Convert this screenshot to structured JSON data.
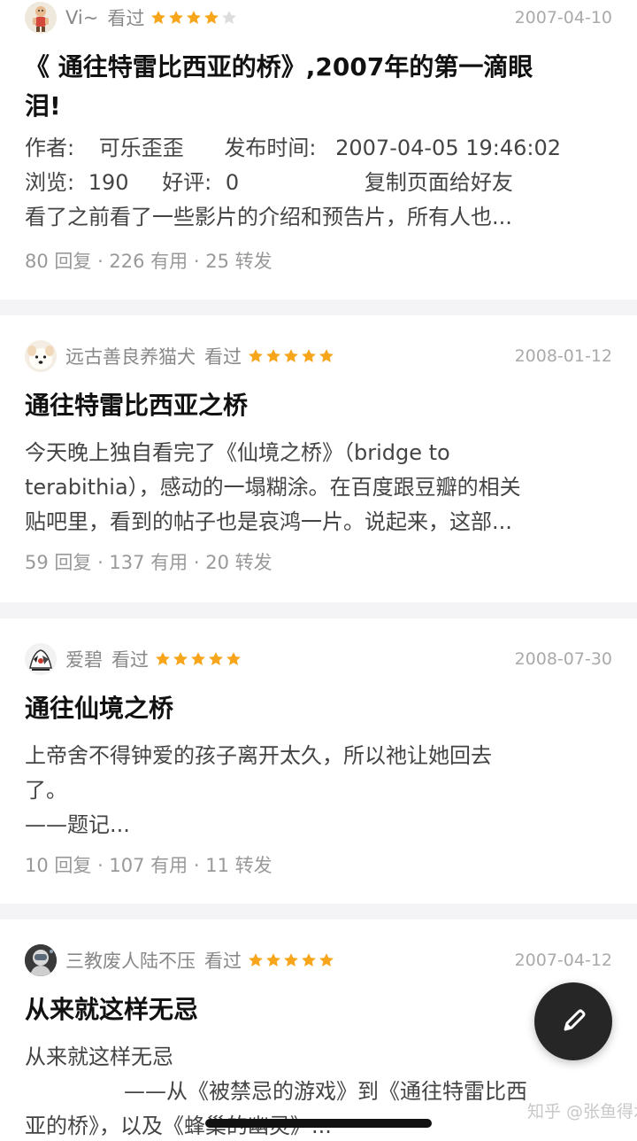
{
  "reviews": [
    {
      "username": "Vi~",
      "status": "看过",
      "rating": 4,
      "date": "2007-04-10",
      "title_line1": "《 通往特雷比西亚的桥》,2007年的第一滴眼",
      "title_line2": "泪!",
      "author_label": "作者:",
      "author_name": "可乐歪歪",
      "publish_label": "发布时间:",
      "publish_time": "2007-04-05 19:46:02",
      "views_label": "浏览:",
      "views_value": "190",
      "likes_label": "好评:",
      "likes_value": "0",
      "copy_text": "复制页面给好友",
      "excerpt": "看了之前看了一些影片的介绍和预告片，所有人也...",
      "stats": "80 回复 · 226 有用 · 25 转发"
    },
    {
      "username": "远古善良养猫犬",
      "status": "看过",
      "rating": 5,
      "date": "2008-01-12",
      "title": "通往特雷比西亚之桥",
      "body_lines": [
        "今天晚上独自看完了《仙境之桥》（bridge to",
        "terabithia），感动的一塌糊涂。在百度跟豆瓣的相关",
        "贴吧里，看到的帖子也是哀鸿一片。说起来，这部..."
      ],
      "stats": "59 回复 · 137 有用 · 20 转发"
    },
    {
      "username": "爱碧",
      "status": "看过",
      "rating": 5,
      "date": "2008-07-30",
      "title": "通往仙境之桥",
      "body_lines": [
        "上帝舍不得钟爱的孩子离开太久，所以祂让她回去",
        "了。",
        "——题记..."
      ],
      "stats": "10 回复 · 107 有用 · 11 转发"
    },
    {
      "username": "三教废人陆不压",
      "status": "看过",
      "rating": 5,
      "date": "2007-04-12",
      "title": "从来就这样无忌",
      "body_lines": [
        "从来就这样无忌",
        "——从《被禁忌的游戏》到《通往特雷比西",
        "亚的桥》，以及《蜂巢的幽灵》..."
      ]
    }
  ],
  "watermark": "知乎 @张鱼得水",
  "fab_icon": "pen-icon",
  "colors": {
    "star": "#f7a61c",
    "star_empty": "#dddddd"
  }
}
